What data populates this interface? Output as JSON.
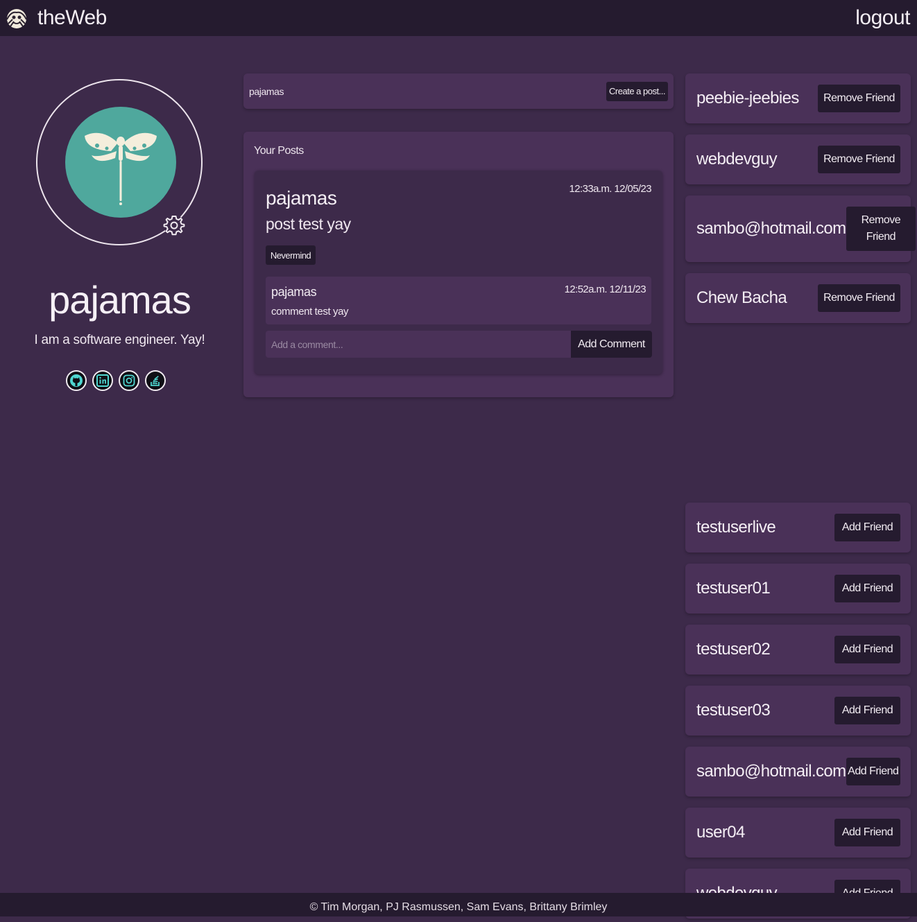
{
  "navbar": {
    "brand": "theWeb",
    "logout": "logout"
  },
  "profile": {
    "username": "pajamas",
    "bio": "I am a software engineer. Yay!",
    "socials": [
      "github-icon",
      "linkedin-icon",
      "instagram-icon",
      "stackoverflow-icon"
    ],
    "avatar_color": "#4fa89d"
  },
  "create_post": {
    "placeholder": "pajamas",
    "button": "Create a post..."
  },
  "posts": {
    "title": "Your Posts",
    "items": [
      {
        "author": "pajamas",
        "body": "post test yay",
        "time": "12:33a.m. 12/05/23",
        "delete_label": "Nevermind",
        "comments": [
          {
            "author": "pajamas",
            "text": "comment test yay",
            "time": "12:52a.m. 12/11/23"
          }
        ],
        "comment_placeholder": "Add a comment...",
        "comment_button": "Add Comment"
      }
    ]
  },
  "friends": [
    {
      "name": "peebie-jeebies",
      "action": "Remove Friend"
    },
    {
      "name": "webdevguy",
      "action": "Remove Friend"
    },
    {
      "name": "sambo@hotmail.com",
      "action": "Remove Friend"
    },
    {
      "name": "Chew Bacha",
      "action": "Remove Friend"
    }
  ],
  "suggested": [
    {
      "name": "testuserlive",
      "action": "Add Friend"
    },
    {
      "name": "testuser01",
      "action": "Add Friend"
    },
    {
      "name": "testuser02",
      "action": "Add Friend"
    },
    {
      "name": "testuser03",
      "action": "Add Friend"
    },
    {
      "name": "sambo@hotmail.com",
      "action": "Add Friend"
    },
    {
      "name": "user04",
      "action": "Add Friend"
    },
    {
      "name": "webdevguy",
      "action": "Add Friend"
    }
  ],
  "footer": "© Tim Morgan, PJ Rasmussen, Sam Evans, Brittany Brimley",
  "colors": {
    "background": "#3d2a4a",
    "card": "#4a3158",
    "navbar": "#251b2f",
    "accent": "#4fa89d"
  }
}
